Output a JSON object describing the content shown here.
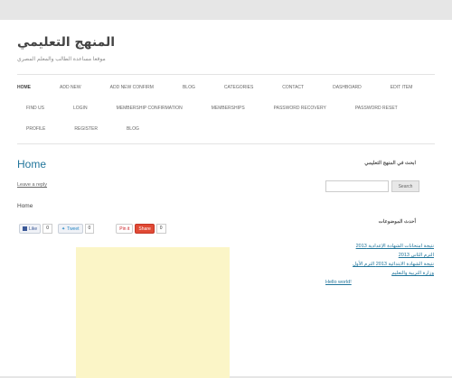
{
  "site": {
    "title": "المنهج التعليمي",
    "description": "موقعا مساعدة الطالب والمعلم المصري"
  },
  "menu": [
    {
      "label": "HOME",
      "current": true
    },
    {
      "label": "ADD NEW"
    },
    {
      "label": "ADD NEW CONFIRM"
    },
    {
      "label": "BLOG"
    },
    {
      "label": "CATEGORIES"
    },
    {
      "label": "CONTACT"
    },
    {
      "label": "DASHBOARD"
    },
    {
      "label": "EDIT ITEM"
    },
    {
      "label": "FIND US"
    },
    {
      "label": "LOGIN"
    },
    {
      "label": "MEMBERSHIP CONFIRMATION"
    },
    {
      "label": "MEMBERSHIPS"
    },
    {
      "label": "PASSWORD RECOVERY"
    },
    {
      "label": "PASSWORD RESET"
    },
    {
      "label": "PROFILE"
    },
    {
      "label": "REGISTER"
    },
    {
      "label": "BLOG"
    }
  ],
  "post": {
    "title": "Home",
    "leave_reply": "Leave a reply",
    "body": "Home"
  },
  "share": {
    "like_label": "Like",
    "like_count": "0",
    "tweet_label": "Tweet",
    "tweet_count": "0",
    "pin_label": "Pin it",
    "gplus_label": "Share",
    "gplus_count": "0"
  },
  "sidebar": {
    "search_title": "ابحث في المنهج التعليمي",
    "search_placeholder": "",
    "search_button": "Search",
    "recent_title": "أحدث الموضوعات",
    "recent_posts": [
      "نتيجة امتحانات الشهادة الإعدادية 2013",
      "الترم الثاني 2013",
      "نتيجة الشهادة الابتدائية 2013 الترم الأول",
      "وزارة التربية والتعليم"
    ],
    "recent_last": "Hello world!"
  },
  "colors": {
    "link": "#21759b",
    "ad_background": "#fbf5c7",
    "page_background": "#e6e6e6"
  }
}
